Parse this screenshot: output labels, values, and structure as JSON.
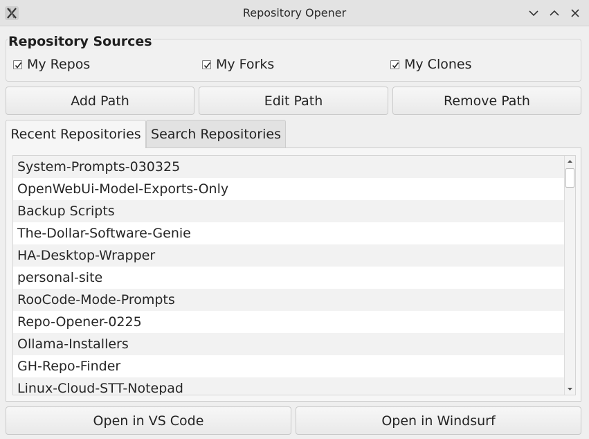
{
  "window": {
    "title": "Repository Opener",
    "icon": "x-app-icon"
  },
  "sources": {
    "title": "Repository Sources",
    "checkboxes": [
      {
        "label": "My Repos",
        "checked": true
      },
      {
        "label": "My Forks",
        "checked": true
      },
      {
        "label": "My Clones",
        "checked": true
      }
    ]
  },
  "path_buttons": {
    "add": "Add Path",
    "edit": "Edit Path",
    "remove": "Remove Path"
  },
  "tabs": [
    {
      "label": "Recent Repositories",
      "active": true
    },
    {
      "label": "Search Repositories",
      "active": false
    }
  ],
  "repositories": [
    "System-Prompts-030325",
    "OpenWebUi-Model-Exports-Only",
    "Backup Scripts",
    "The-Dollar-Software-Genie",
    "HA-Desktop-Wrapper",
    "personal-site",
    "RooCode-Mode-Prompts",
    "Repo-Opener-0225",
    "Ollama-Installers",
    "GH-Repo-Finder",
    "Linux-Cloud-STT-Notepad"
  ],
  "open_buttons": {
    "vscode": "Open in VS Code",
    "windsurf": "Open in Windsurf"
  }
}
